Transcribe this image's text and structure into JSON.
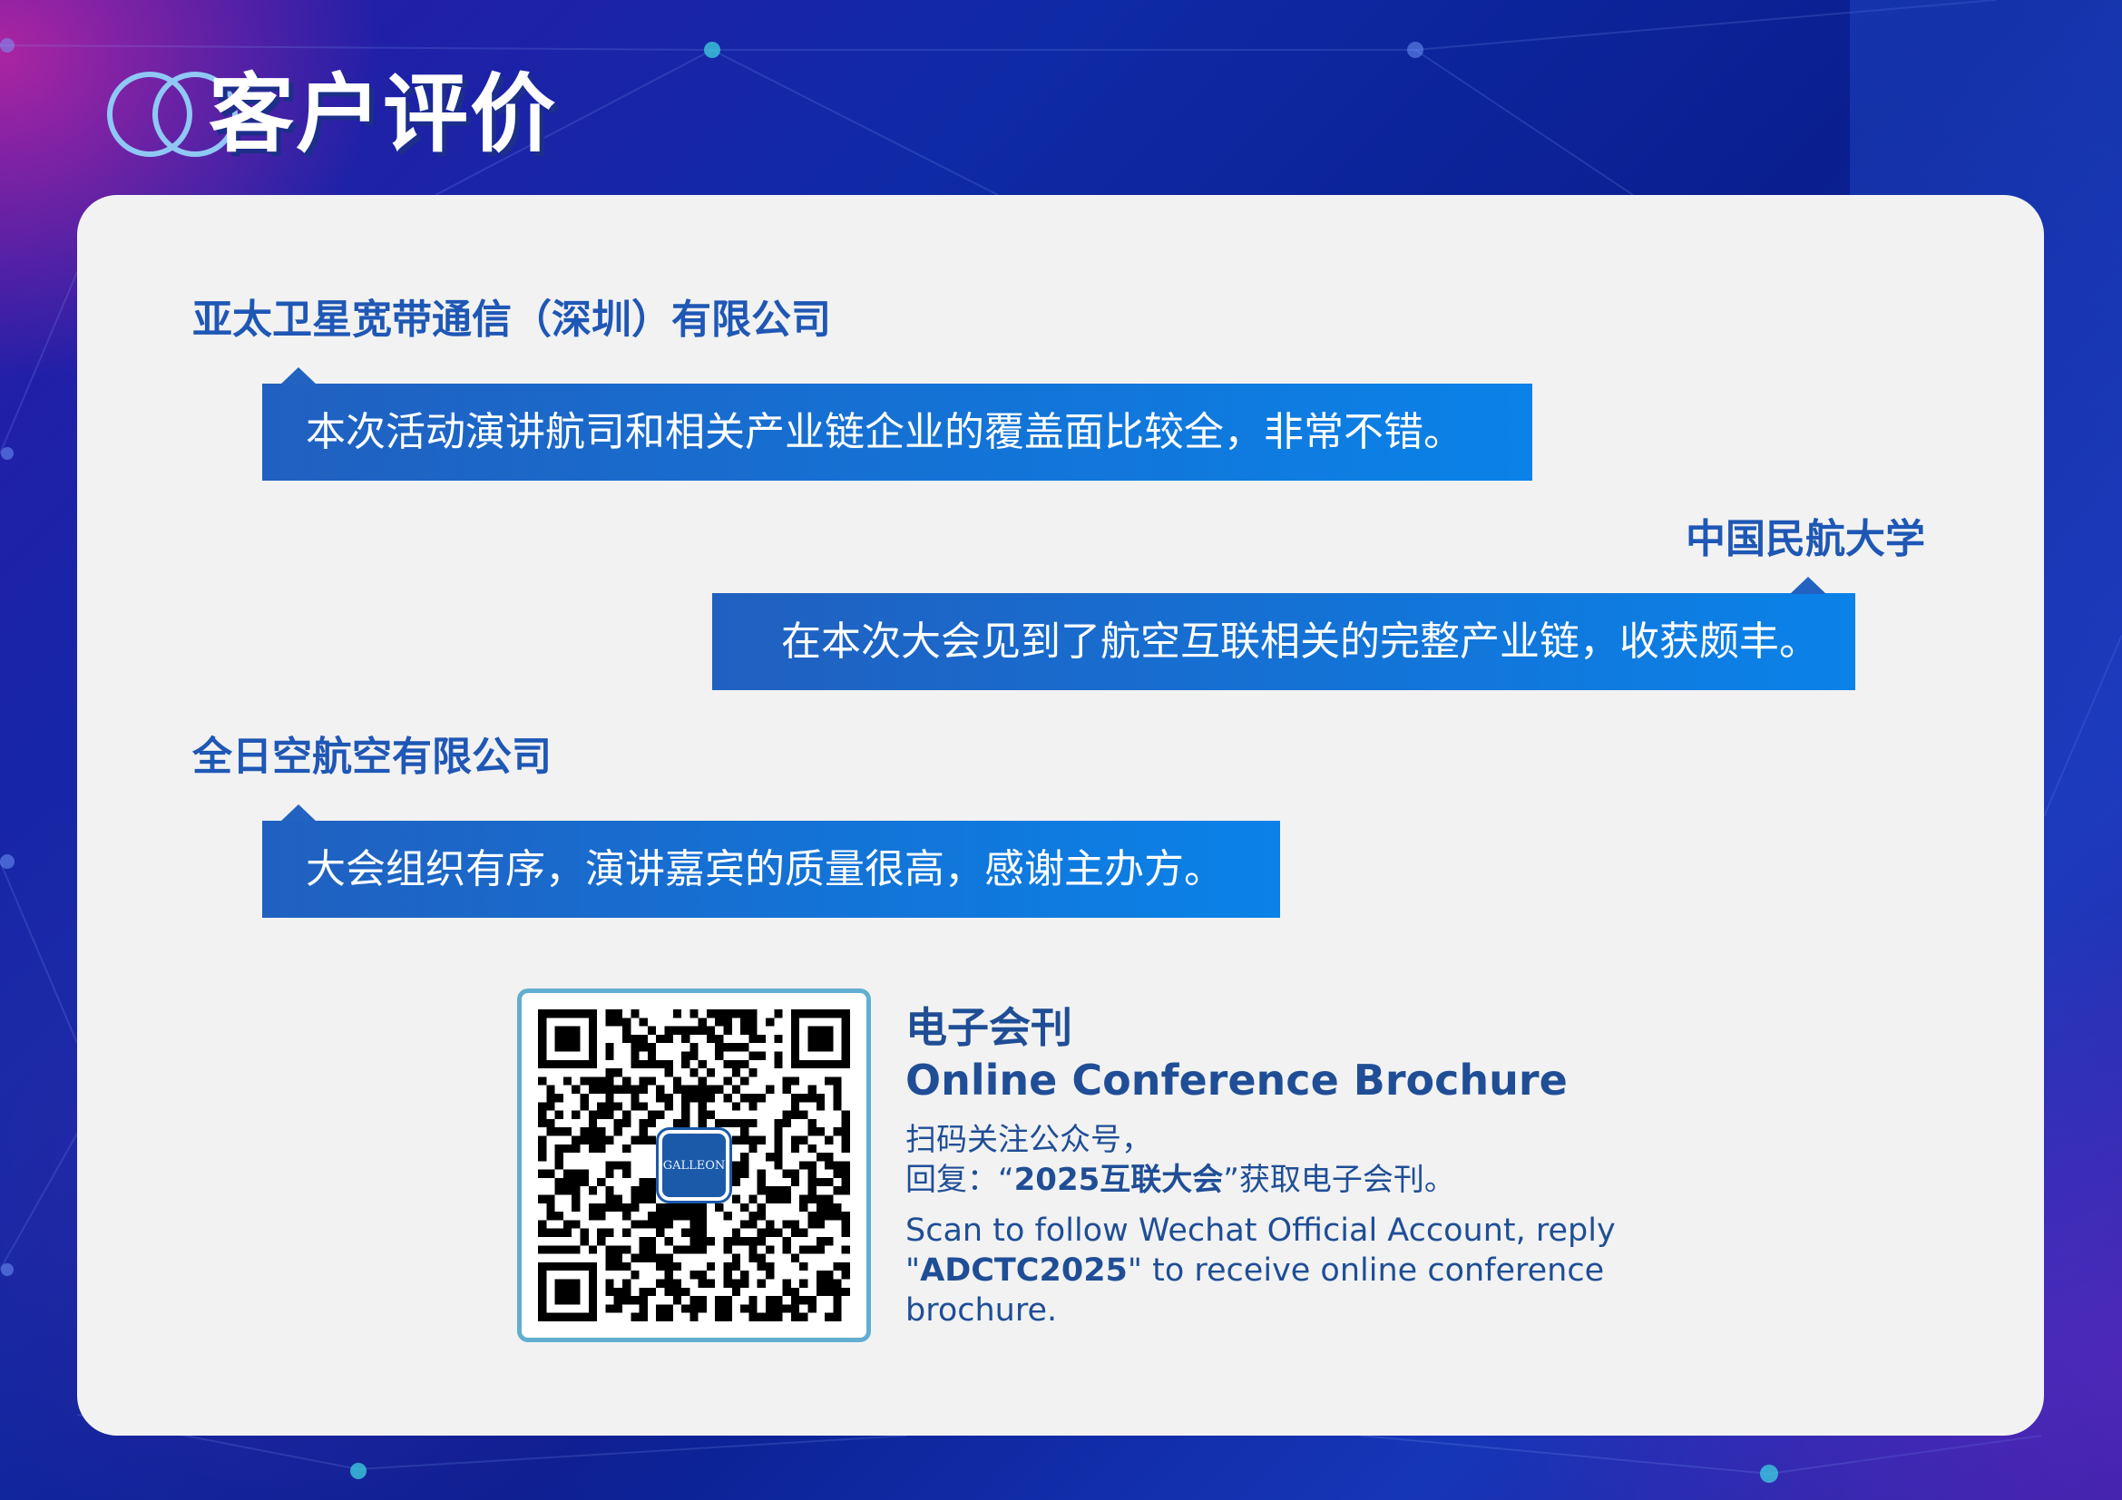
{
  "page": {
    "title": "客户评价"
  },
  "testimonials": [
    {
      "company": "亚太卫星宽带通信（深圳）有限公司",
      "quote": "本次活动演讲航司和相关产业链企业的覆盖面比较全，非常不错。"
    },
    {
      "company": "中国民航大学",
      "quote": "在本次大会见到了航空互联相关的完整产业链，收获颇丰。"
    },
    {
      "company": "全日空航空有限公司",
      "quote": "大会组织有序，演讲嘉宾的质量很高，感谢主办方。"
    }
  ],
  "brochure": {
    "cn_title": "电子会刊",
    "en_title": "Online Conference Brochure",
    "cn_line1": "扫码关注公众号，",
    "cn_line2_prefix": "回复：“",
    "cn_keyword": "2025互联大会",
    "cn_line2_suffix": "”获取电子会刊。",
    "en_prefix": "Scan to follow Wechat Official Account, reply \"",
    "en_keyword": "ADCTC2025",
    "en_suffix": "\" to receive online conference brochure.",
    "qr_logo_text": "GALLEON"
  },
  "colors": {
    "accent_blue": "#1f57b5",
    "bubble_start": "#2060c0",
    "bubble_end": "#0a82e8",
    "card_bg": "#f2f2f2",
    "qr_border": "#62aed0"
  }
}
